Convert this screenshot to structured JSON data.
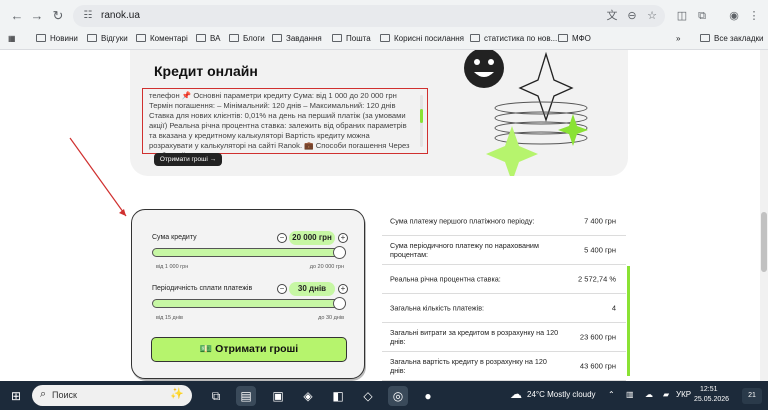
{
  "browser": {
    "url": "ranok.ua",
    "bookmarks": [
      "Новини",
      "Відгуки",
      "Коментарі",
      "ВА",
      "Блоги",
      "Завдання",
      "Пошта",
      "Корисні посилання",
      "статистика по нов...",
      "МФО"
    ],
    "more_chevron": "»",
    "all_bookmarks": "Все закладки"
  },
  "hero": {
    "title": "Кредит онлайн",
    "text": "телефон 📌 Основні параметри кредиту Сума: від 1 000 до 20 000 грн Термін погашення: – Мінімальний: 120 днів – Максимальний: 120 днів Ставка для нових клієнтів: 0,01% на день на перший платіж (за умовами акції) Реальна річна процентна ставка: залежить від обраних параметрів та вказана у кредитному калькуляторі Вартість кредиту можна розрахувати у калькуляторі на сайті Ranok. 💼 Способи погашення Через особистий",
    "button": "Отримати гроші →"
  },
  "calculator": {
    "amount_label": "Сума кредиту",
    "amount_value": "20 000 грн",
    "amount_min": "від 1 000 грн",
    "amount_max": "до 20 000 грн",
    "period_label": "Періодичність сплати платежів",
    "period_value": "30 днів",
    "period_min": "від 15 днів",
    "period_max": "до 30 днів",
    "submit": "Отримати гроші",
    "amount_fill": 1.0,
    "period_fill": 1.0
  },
  "results": [
    {
      "label": "Сума платежу першого платіжного періоду:",
      "value": "7 400 грн"
    },
    {
      "label": "Сума періодичного платежу по нарахованим процентам:",
      "value": "5 400 грн"
    },
    {
      "label": "Реальна річна процентна ставка:",
      "value": "2 572,74 %"
    },
    {
      "label": "Загальна кількість платежів:",
      "value": "4"
    },
    {
      "label": "Загальні витрати за кредитом в розрахунку на 120 днів:",
      "value": "23 600 грн"
    },
    {
      "label": "Загальна вартість кредиту в розрахунку на 120 днів:",
      "value": "43 600 грн"
    }
  ],
  "taskbar": {
    "search": "Поиск",
    "weather": "24°C  Mostly cloudy",
    "lang": "УКР",
    "time": "12:51",
    "date": "25.05.2026",
    "notif": "21"
  },
  "colors": {
    "accent_green": "#b6f46d",
    "highlight_red": "#d0302f"
  }
}
